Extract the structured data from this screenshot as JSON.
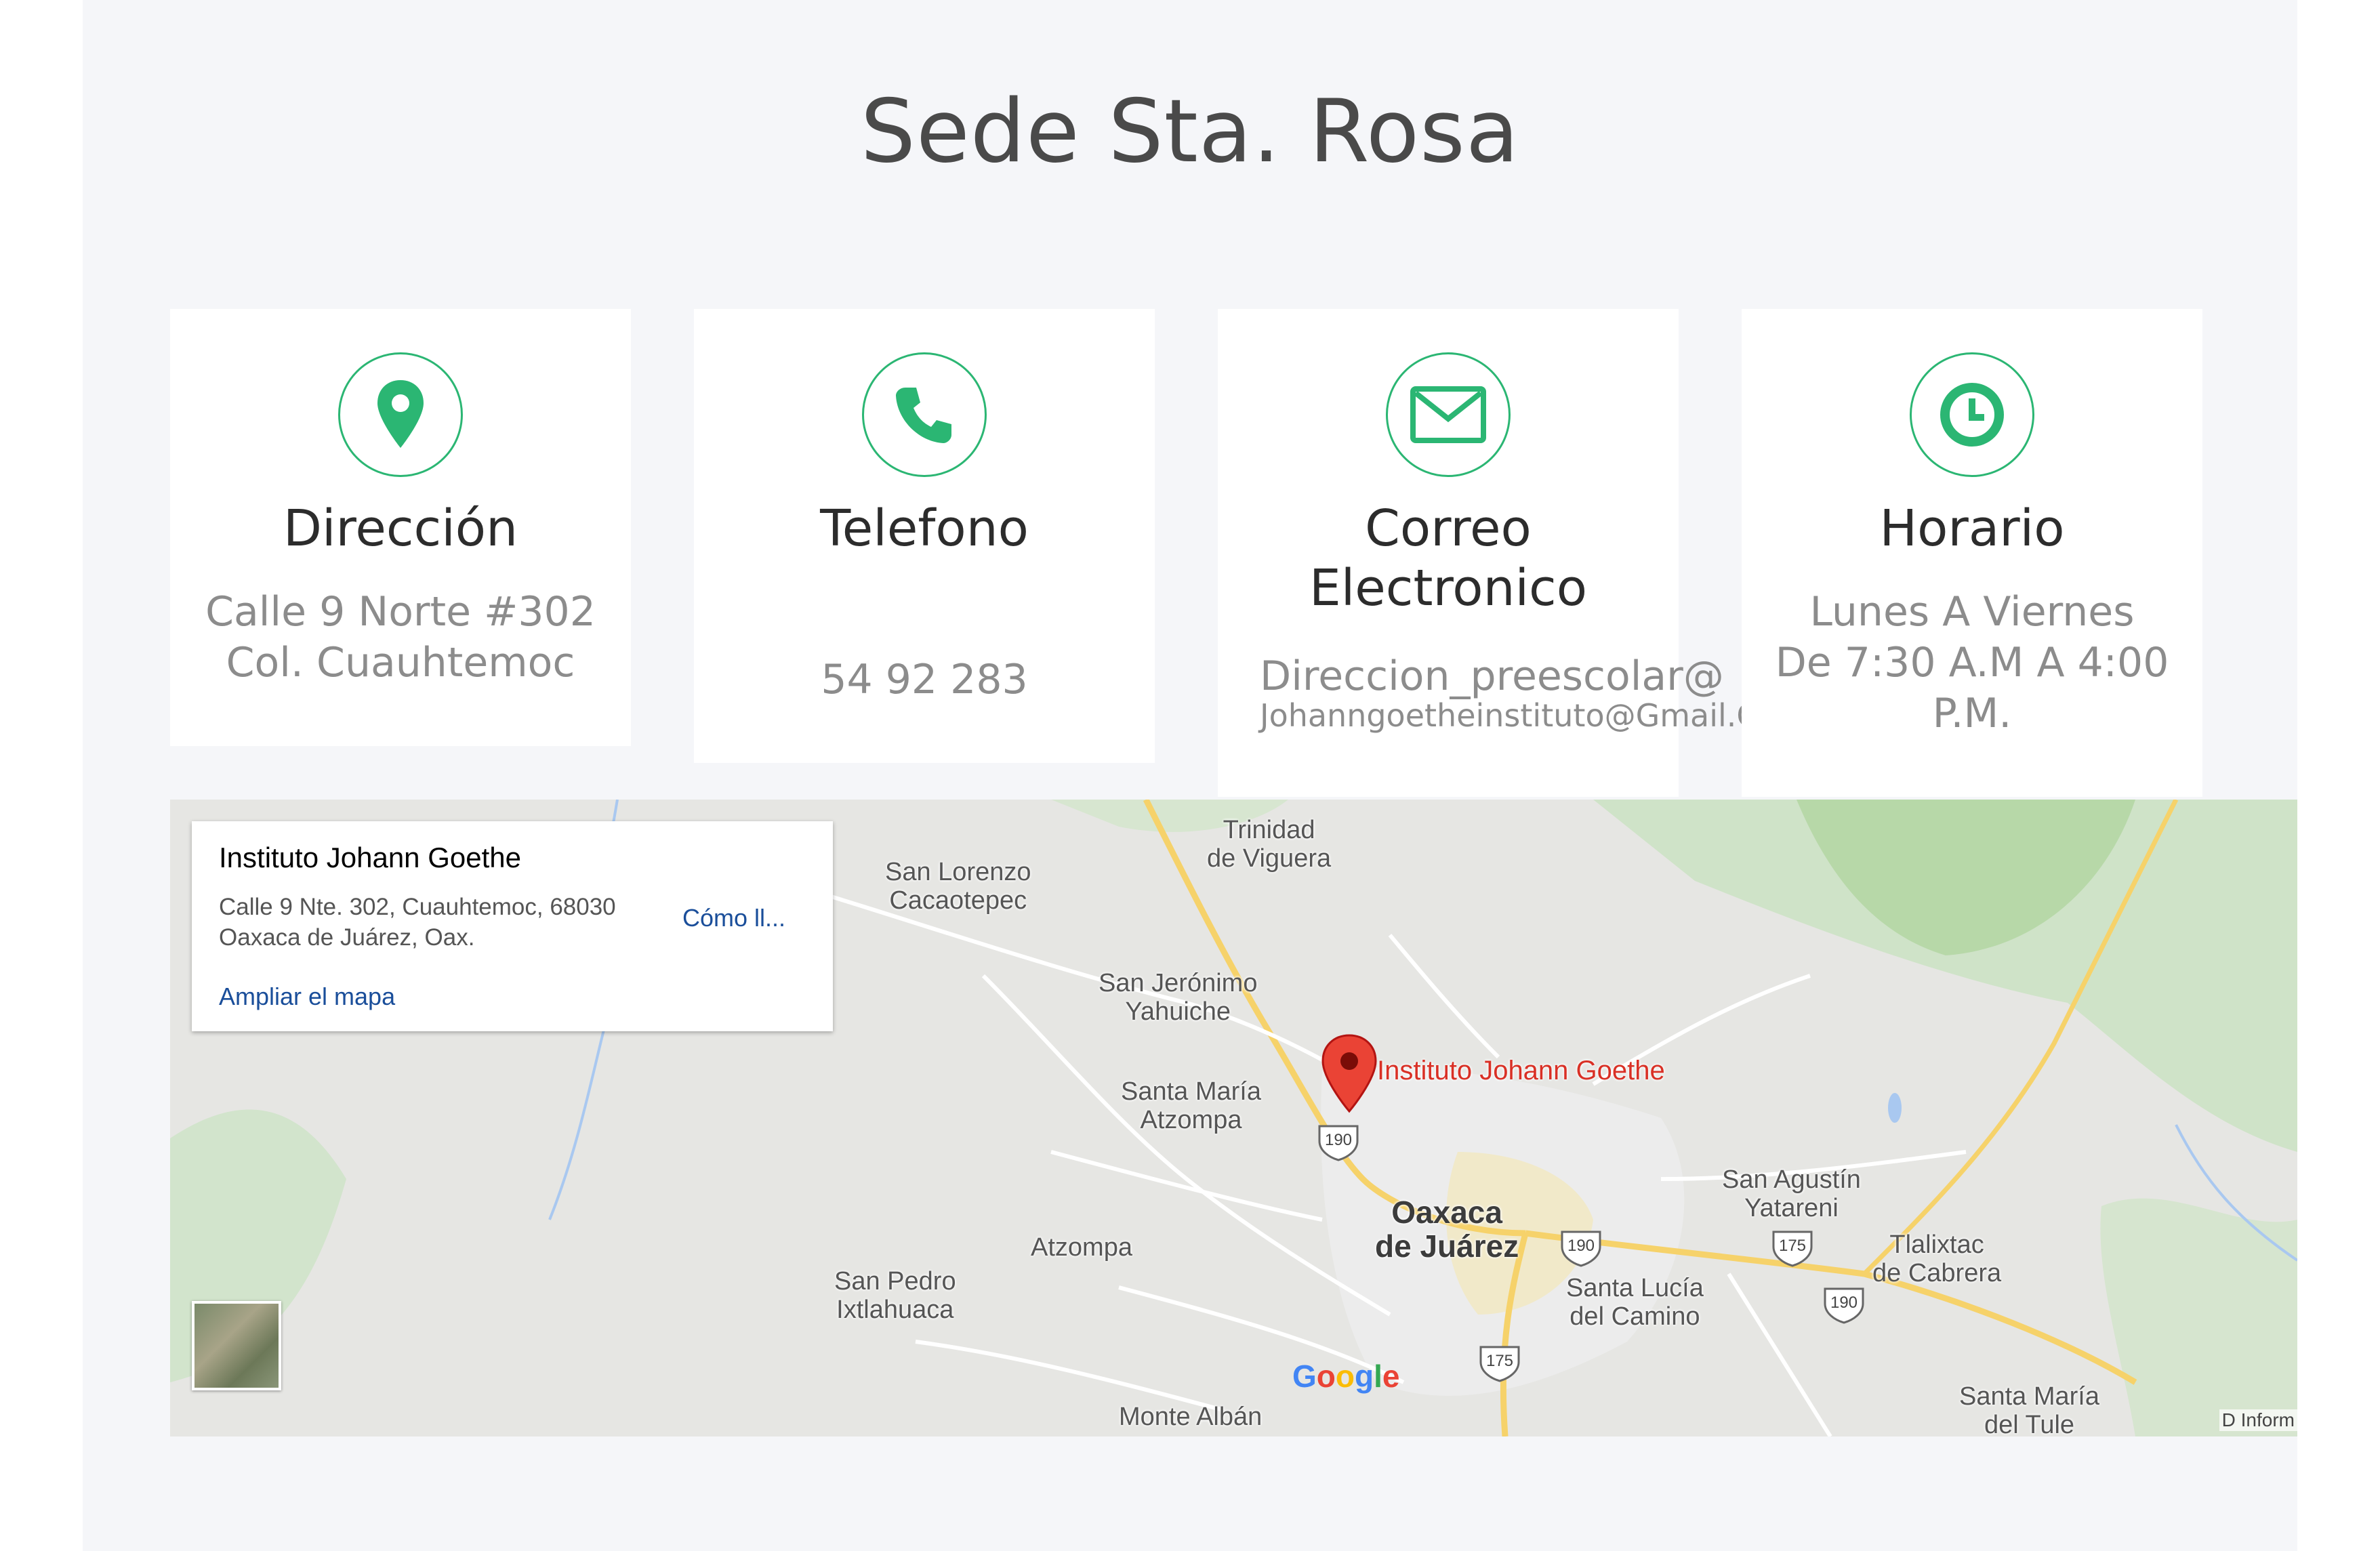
{
  "section": {
    "title": "Sede Sta. Rosa"
  },
  "cards": [
    {
      "icon": "location-pin-icon",
      "title": "Dirección",
      "lines": [
        "Calle 9 Norte #302",
        "Col. Cuauhtemoc"
      ]
    },
    {
      "icon": "phone-icon",
      "title": "Telefono",
      "lines": [
        "54 92 283"
      ]
    },
    {
      "icon": "envelope-icon",
      "title_lines": [
        "Correo",
        "Electronico"
      ],
      "lines": [
        "Direccion_preescolar@",
        "Johanngoetheinstituto@Gmail.C"
      ]
    },
    {
      "icon": "clock-icon",
      "title": "Horario",
      "lines": [
        "Lunes A Viernes",
        "De 7:30 A.M A 4:00",
        "P.M."
      ]
    }
  ],
  "map": {
    "info_box": {
      "name": "Instituto Johann Goethe",
      "address_line1": "Calle 9 Nte. 302, Cuauhtemoc, 68030",
      "address_line2": "Oaxaca de Juárez, Oax.",
      "directions_label": "Cómo ll...",
      "enlarge_label": "Ampliar el mapa"
    },
    "pin_label": "Instituto Johann Goethe",
    "places": [
      {
        "id": "trinidad",
        "l1": "Trinidad",
        "l2": "de Viguera"
      },
      {
        "id": "san-lorenzo",
        "l1": "San Lorenzo",
        "l2": "Cacaotepec"
      },
      {
        "id": "san-jeronimo",
        "l1": "San Jerónimo",
        "l2": "Yahuiche"
      },
      {
        "id": "santa-maria-atzompa",
        "l1": "Santa María",
        "l2": "Atzompa"
      },
      {
        "id": "atzompa",
        "l1": "Atzompa",
        "l2": ""
      },
      {
        "id": "san-pedro",
        "l1": "San Pedro",
        "l2": "Ixtlahuaca"
      },
      {
        "id": "monte-alban",
        "l1": "Monte Albán",
        "l2": ""
      },
      {
        "id": "santa-lucia",
        "l1": "Santa Lucía",
        "l2": "del Camino"
      },
      {
        "id": "san-agustin",
        "l1": "San Agustín",
        "l2": "Yatareni"
      },
      {
        "id": "tlalixtac",
        "l1": "Tlalixtac",
        "l2": "de Cabrera"
      },
      {
        "id": "santa-maria-tule",
        "l1": "Santa María",
        "l2": "del Tule"
      }
    ],
    "city": {
      "l1": "Oaxaca",
      "l2": "de Juárez"
    },
    "highway_shields": [
      "190",
      "190",
      "175",
      "190",
      "175"
    ],
    "google_logo": "Google",
    "attribution": "Datos del mapa",
    "attribution_visible": "D  Inform"
  },
  "colors": {
    "accent": "#2bb673",
    "page_bg": "#f5f6f9",
    "card_bg": "#ffffff",
    "pin": "#ea4335",
    "link": "#1a4e9a"
  }
}
